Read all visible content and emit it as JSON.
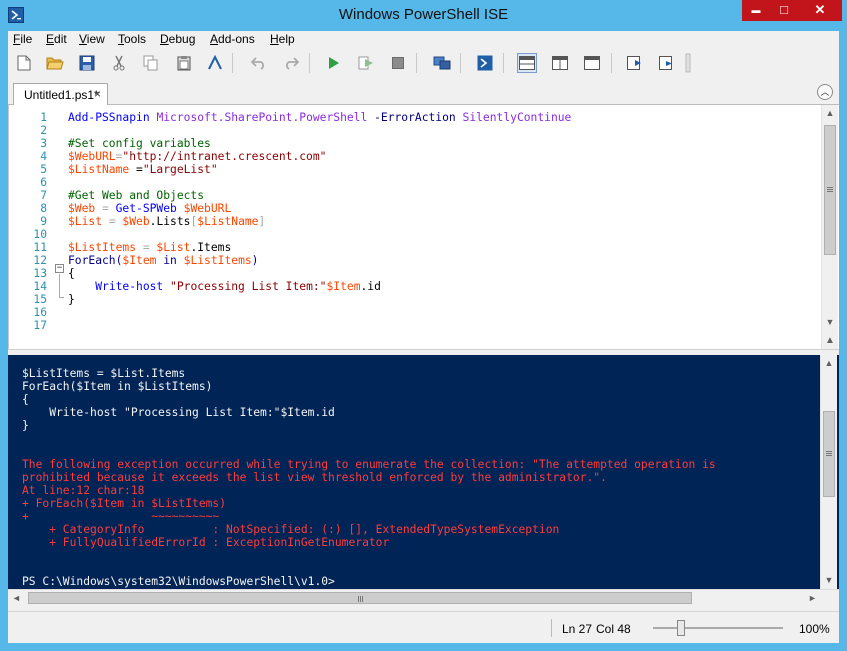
{
  "window": {
    "title": "Windows PowerShell ISE",
    "buttons": {
      "minimize": "▬",
      "maximize": "□",
      "close": "✕"
    }
  },
  "menubar": {
    "items": [
      {
        "first": "F",
        "rest": "ile"
      },
      {
        "first": "E",
        "rest": "dit"
      },
      {
        "first": "V",
        "rest": "iew"
      },
      {
        "first": "T",
        "rest": "ools"
      },
      {
        "first": "D",
        "rest": "ebug"
      },
      {
        "first": "A",
        "rest": "dd-ons"
      },
      {
        "first": "H",
        "rest": "elp"
      }
    ]
  },
  "toolbar": {
    "icons": [
      "new-file-icon",
      "open-folder-icon",
      "save-icon",
      "cut-icon",
      "copy-icon",
      "paste-icon",
      "clear-console-icon",
      "undo-icon",
      "redo-icon",
      "run-script-icon",
      "run-selection-icon",
      "stop-icon",
      "remote-powershell-icon",
      "powershell-console-icon",
      "show-script-pane-top-icon",
      "show-script-pane-right-icon",
      "show-script-pane-maximized-icon",
      "show-command-window-icon",
      "show-command-addon-icon"
    ]
  },
  "tabs": {
    "active_label": "Untitled1.ps1*",
    "close_glyph": "×",
    "collapse_glyph": "︿"
  },
  "editor": {
    "line_numbers": [
      "1",
      "2",
      "3",
      "4",
      "5",
      "6",
      "7",
      "8",
      "9",
      "10",
      "11",
      "12",
      "13",
      "14",
      "15",
      "16",
      "17"
    ],
    "lines": [
      [
        {
          "t": "Add-PSSnapin",
          "c": "c-cmd"
        },
        {
          "t": " "
        },
        {
          "t": "Microsoft.SharePoint.PowerShell",
          "c": "c-arg"
        },
        {
          "t": " "
        },
        {
          "t": "-ErrorAction",
          "c": "c-param"
        },
        {
          "t": " "
        },
        {
          "t": "SilentlyContinue",
          "c": "c-arg"
        }
      ],
      [],
      [
        {
          "t": "#Set config variables",
          "c": "c-cmt"
        }
      ],
      [
        {
          "t": "$WebURL",
          "c": "c-var"
        },
        {
          "t": "=",
          "c": "c-op"
        },
        {
          "t": "\"http://intranet.crescent.com\"",
          "c": "c-str"
        }
      ],
      [
        {
          "t": "$ListName",
          "c": "c-var"
        },
        {
          "t": " ="
        },
        {
          "t": "\"LargeList\"",
          "c": "c-str"
        }
      ],
      [],
      [
        {
          "t": "#Get Web and Objects",
          "c": "c-cmt"
        }
      ],
      [
        {
          "t": "$Web",
          "c": "c-var"
        },
        {
          "t": " = ",
          "c": "c-op"
        },
        {
          "t": "Get-SPWeb",
          "c": "c-cmd"
        },
        {
          "t": " "
        },
        {
          "t": "$WebURL",
          "c": "c-var"
        }
      ],
      [
        {
          "t": "$List",
          "c": "c-var"
        },
        {
          "t": " = ",
          "c": "c-op"
        },
        {
          "t": "$Web",
          "c": "c-var"
        },
        {
          "t": ".Lists",
          "c": "c-mem"
        },
        {
          "t": "[",
          "c": "c-op"
        },
        {
          "t": "$ListName",
          "c": "c-var"
        },
        {
          "t": "]",
          "c": "c-op"
        }
      ],
      [],
      [
        {
          "t": "$ListItems",
          "c": "c-var"
        },
        {
          "t": " = ",
          "c": "c-op"
        },
        {
          "t": "$List",
          "c": "c-var"
        },
        {
          "t": ".Items",
          "c": "c-mem"
        }
      ],
      [
        {
          "t": "ForEach(",
          "c": "c-kw"
        },
        {
          "t": "$Item",
          "c": "c-var"
        },
        {
          "t": " in ",
          "c": "c-kw"
        },
        {
          "t": "$ListItems",
          "c": "c-var"
        },
        {
          "t": ")",
          "c": "c-kw"
        }
      ],
      [
        {
          "t": "{"
        }
      ],
      [
        {
          "t": "    "
        },
        {
          "t": "Write-host",
          "c": "c-cmd"
        },
        {
          "t": " "
        },
        {
          "t": "\"Processing List Item:\"",
          "c": "c-str"
        },
        {
          "t": "$Item",
          "c": "c-var"
        },
        {
          "t": ".id",
          "c": "c-mem"
        }
      ],
      [
        {
          "t": "}"
        }
      ],
      [],
      []
    ],
    "fold_glyph": "−"
  },
  "console": {
    "lines": [
      {
        "text": "$ListItems = $List.Items",
        "err": false
      },
      {
        "text": "ForEach($Item in $ListItems)",
        "err": false
      },
      {
        "text": "{",
        "err": false
      },
      {
        "text": "    Write-host \"Processing List Item:\"$Item.id",
        "err": false
      },
      {
        "text": "}",
        "err": false
      },
      {
        "text": "",
        "err": false
      },
      {
        "text": "",
        "err": false
      },
      {
        "text": "The following exception occurred while trying to enumerate the collection: \"The attempted operation is",
        "err": true
      },
      {
        "text": "prohibited because it exceeds the list view threshold enforced by the administrator.\".",
        "err": true
      },
      {
        "text": "At line:12 char:18",
        "err": true
      },
      {
        "text": "+ ForEach($Item in $ListItems)",
        "err": true
      },
      {
        "text": "+                  ~~~~~~~~~~",
        "err": true
      },
      {
        "text": "    + CategoryInfo          : NotSpecified: (:) [], ExtendedTypeSystemException",
        "err": true
      },
      {
        "text": "    + FullyQualifiedErrorId : ExceptionInGetEnumerator",
        "err": true
      },
      {
        "text": "",
        "err": false
      },
      {
        "text": "",
        "err": false
      },
      {
        "text": "PS C:\\Windows\\system32\\WindowsPowerShell\\v1.0>",
        "err": false
      }
    ]
  },
  "statusbar": {
    "line": "Ln 27",
    "col": "Col 48",
    "zoom": "100%"
  },
  "scroll": {
    "up": "▲",
    "down": "▼",
    "left": "◄",
    "right": "►"
  }
}
